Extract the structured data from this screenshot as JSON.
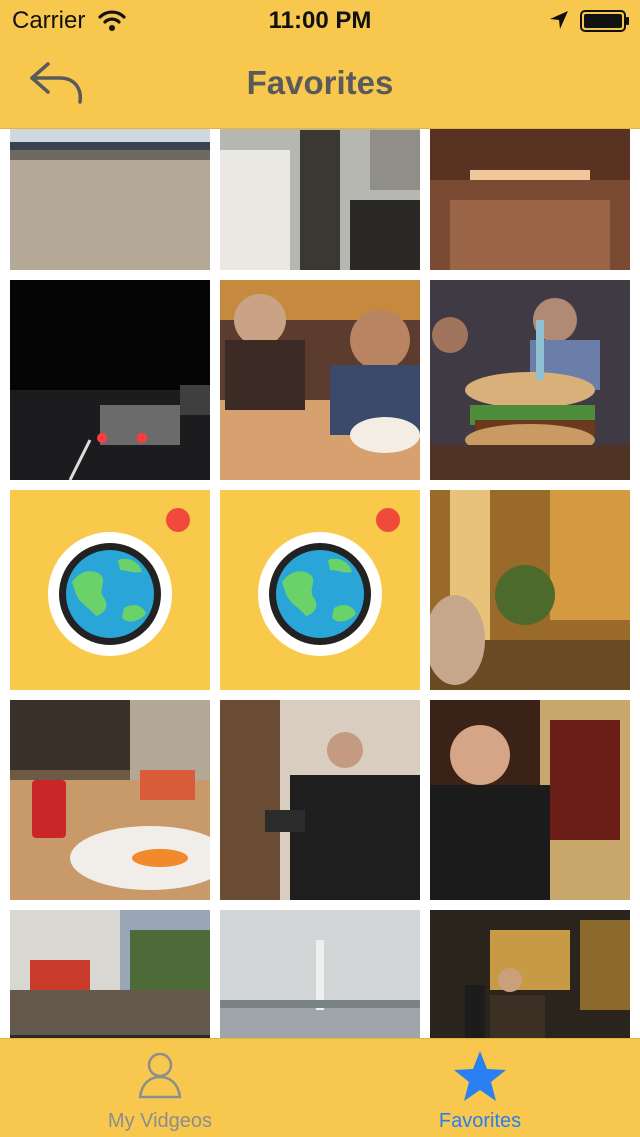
{
  "status_bar": {
    "carrier": "Carrier",
    "time": "11:00 PM"
  },
  "nav": {
    "title": "Favorites"
  },
  "tabs": [
    {
      "label": "My Vidgeos",
      "icon": "person-icon",
      "active": false
    },
    {
      "label": "Favorites",
      "icon": "star-icon",
      "active": true
    }
  ],
  "grid": {
    "tiles": [
      {
        "kind": "photo",
        "subject": "pavement by the sea"
      },
      {
        "kind": "photo",
        "subject": "city street, rotated"
      },
      {
        "kind": "photo",
        "subject": "restaurant interior"
      },
      {
        "kind": "photo",
        "subject": "night highway traffic"
      },
      {
        "kind": "photo",
        "subject": "two men at a table"
      },
      {
        "kind": "photo",
        "subject": "burger with candle"
      },
      {
        "kind": "placeholder",
        "icon": "globe-camera-icon"
      },
      {
        "kind": "placeholder",
        "icon": "globe-camera-icon"
      },
      {
        "kind": "photo",
        "subject": "blurry restaurant"
      },
      {
        "kind": "photo",
        "subject": "drinks on table"
      },
      {
        "kind": "photo",
        "subject": "man with camera"
      },
      {
        "kind": "photo",
        "subject": "man in dark room"
      },
      {
        "kind": "photo",
        "subject": "city street"
      },
      {
        "kind": "photo",
        "subject": "water fountain"
      },
      {
        "kind": "photo",
        "subject": "street musician"
      }
    ]
  },
  "colors": {
    "bar": "#f7c84d",
    "active_tab": "#2a7ff2",
    "inactive_tab": "#8d8d8d",
    "title": "#5a5a5a"
  }
}
